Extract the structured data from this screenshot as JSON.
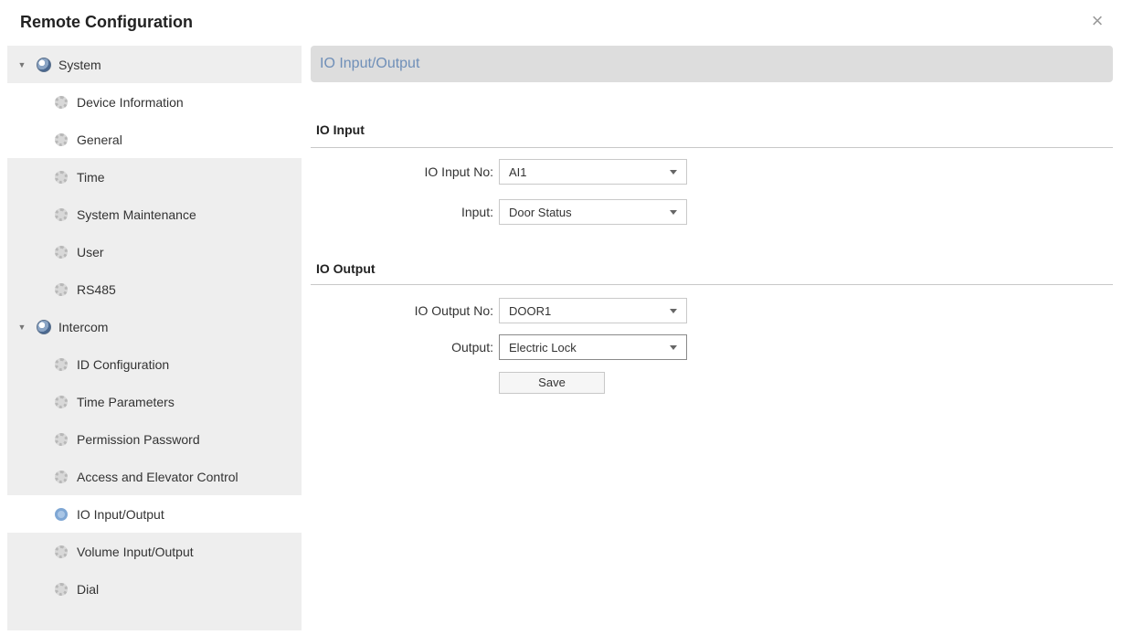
{
  "window": {
    "title": "Remote Configuration",
    "close_symbol": "×"
  },
  "sidebar": {
    "groups": [
      {
        "label": "System",
        "items": [
          "Device Information",
          "General",
          "Time",
          "System Maintenance",
          "User",
          "RS485"
        ]
      },
      {
        "label": "Intercom",
        "items": [
          "ID Configuration",
          "Time Parameters",
          "Permission Password",
          "Access and Elevator Control",
          "IO Input/Output",
          "Volume Input/Output",
          "Dial"
        ]
      }
    ],
    "selected": "IO Input/Output"
  },
  "content": {
    "header": "IO Input/Output",
    "io_input": {
      "title": "IO Input",
      "no_label": "IO Input No:",
      "no_value": "AI1",
      "input_label": "Input:",
      "input_value": "Door Status"
    },
    "io_output": {
      "title": "IO Output",
      "no_label": "IO Output No:",
      "no_value": "DOOR1",
      "output_label": "Output:",
      "output_value": "Electric Lock"
    },
    "save_label": "Save"
  },
  "colors": {
    "sidebar_bg": "#eeeeee",
    "header_bg": "#dddddd",
    "header_text": "#6f8fb8"
  }
}
